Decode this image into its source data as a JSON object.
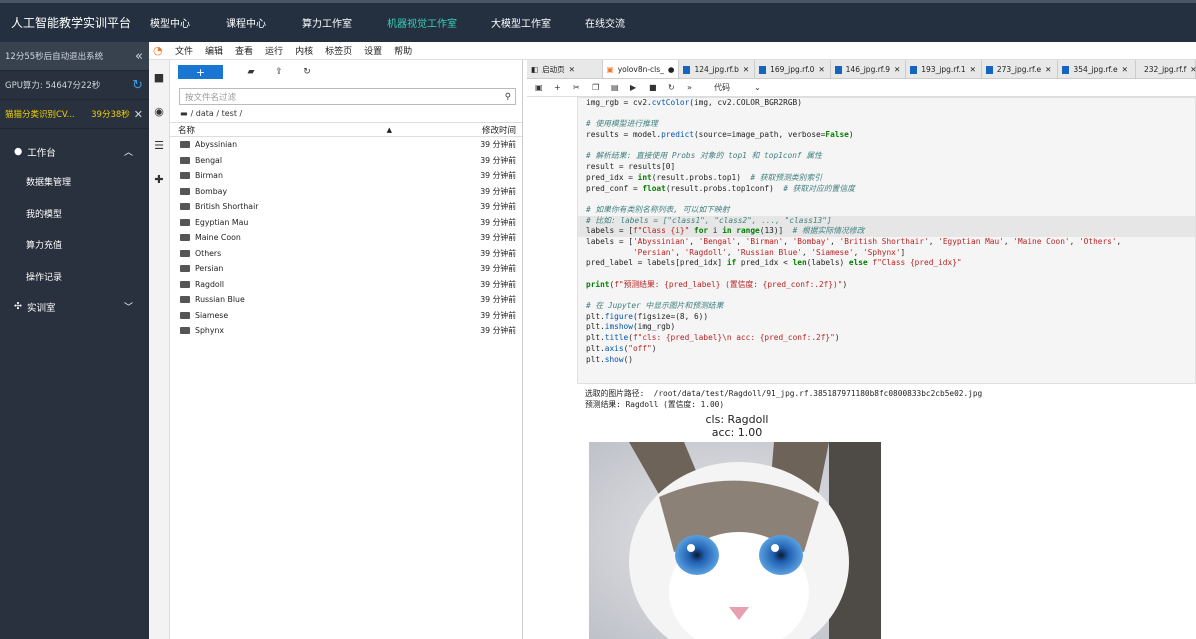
{
  "topbar": {
    "brand": "人工智能教学实训平台",
    "nav": [
      "模型中心",
      "课程中心",
      "算力工作室",
      "机器视觉工作室",
      "大模型工作室",
      "在线交流"
    ]
  },
  "sidebar": {
    "logout_notice": "12分55秒后自动退出系统",
    "gpu": "GPU算力: 54647分22秒",
    "task_name": "猫猫分类识别CV...",
    "task_time": "39分38秒",
    "group_workbench": "工作台",
    "items": [
      "数据集管理",
      "我的模型",
      "算力充值",
      "操作记录"
    ],
    "group_lab": "实训室"
  },
  "menubar": [
    "文件",
    "编辑",
    "查看",
    "运行",
    "内核",
    "标签页",
    "设置",
    "帮助"
  ],
  "filebrowser": {
    "new_label": "+",
    "filter_placeholder": "按文件名过滤",
    "breadcrumb": "/ data / test /",
    "col_name": "名称",
    "col_modified": "修改时间",
    "rows": [
      {
        "name": "Abyssinian",
        "time": "39 分钟前"
      },
      {
        "name": "Bengal",
        "time": "39 分钟前"
      },
      {
        "name": "Birman",
        "time": "39 分钟前"
      },
      {
        "name": "Bombay",
        "time": "39 分钟前"
      },
      {
        "name": "British Shorthair",
        "time": "39 分钟前"
      },
      {
        "name": "Egyptian Mau",
        "time": "39 分钟前"
      },
      {
        "name": "Maine Coon",
        "time": "39 分钟前"
      },
      {
        "name": "Others",
        "time": "39 分钟前"
      },
      {
        "name": "Persian",
        "time": "39 分钟前"
      },
      {
        "name": "Ragdoll",
        "time": "39 分钟前"
      },
      {
        "name": "Russian Blue",
        "time": "39 分钟前"
      },
      {
        "name": "Siamese",
        "time": "39 分钟前"
      },
      {
        "name": "Sphynx",
        "time": "39 分钟前"
      }
    ]
  },
  "tabs": [
    "启动页",
    "yolov8n-cls_",
    "124_jpg.rf.b",
    "169_jpg.rf.0",
    "146_jpg.rf.9",
    "193_jpg.rf.1",
    "273_jpg.rf.e",
    "354_jpg.rf.e",
    "232_jpg.rf.f"
  ],
  "notebook": {
    "cell_type": "代码",
    "output_path": "选取的图片路径:  /root/data/test/Ragdoll/91_jpg.rf.385187971180b8fc0800833bc2cb5e02.jpg",
    "output_result": "预测结果: Ragdoll (置信度: 1.00)",
    "fig_title_1": "cls: Ragdoll",
    "fig_title_2": "acc: 1.00"
  }
}
